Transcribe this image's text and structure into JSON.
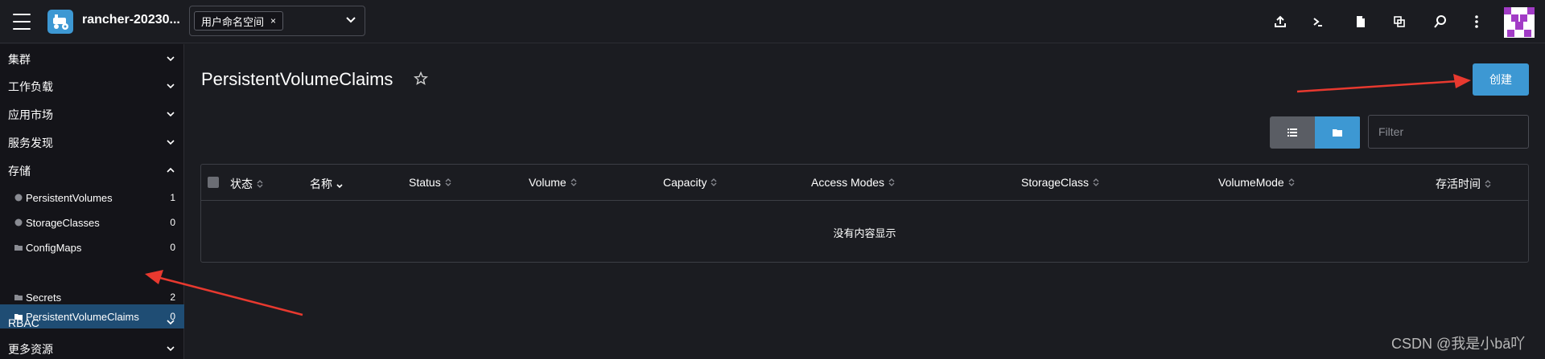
{
  "header": {
    "cluster_name": "rancher-20230...",
    "namespace_chip": "用户命名空间",
    "namespace_chip_remove": "×"
  },
  "sidebar": {
    "groups": [
      {
        "label": "集群"
      },
      {
        "label": "工作负载"
      },
      {
        "label": "应用市场"
      },
      {
        "label": "服务发现"
      },
      {
        "label": "存储"
      },
      {
        "label": "RBAC"
      },
      {
        "label": "更多资源"
      }
    ],
    "storage_items": [
      {
        "label": "PersistentVolumes",
        "count": "1",
        "icon": "globe-icon"
      },
      {
        "label": "StorageClasses",
        "count": "0",
        "icon": "globe-icon"
      },
      {
        "label": "ConfigMaps",
        "count": "0",
        "icon": "folder-icon"
      },
      {
        "label": "PersistentVolumeClaims",
        "count": "0",
        "icon": "folder-icon"
      },
      {
        "label": "Secrets",
        "count": "2",
        "icon": "folder-icon"
      }
    ]
  },
  "main": {
    "title": "PersistentVolumeClaims",
    "create_label": "创建",
    "filter_placeholder": "Filter",
    "columns": [
      "状态",
      "名称",
      "Status",
      "Volume",
      "Capacity",
      "Access Modes",
      "StorageClass",
      "VolumeMode",
      "存活时间"
    ],
    "empty_text": "没有内容显示"
  },
  "watermark": "CSDN @我是小bā吖",
  "colors": {
    "accent": "#3d98d3",
    "active_nav": "#1f4d74",
    "annotation_arrow": "#e8392f"
  }
}
